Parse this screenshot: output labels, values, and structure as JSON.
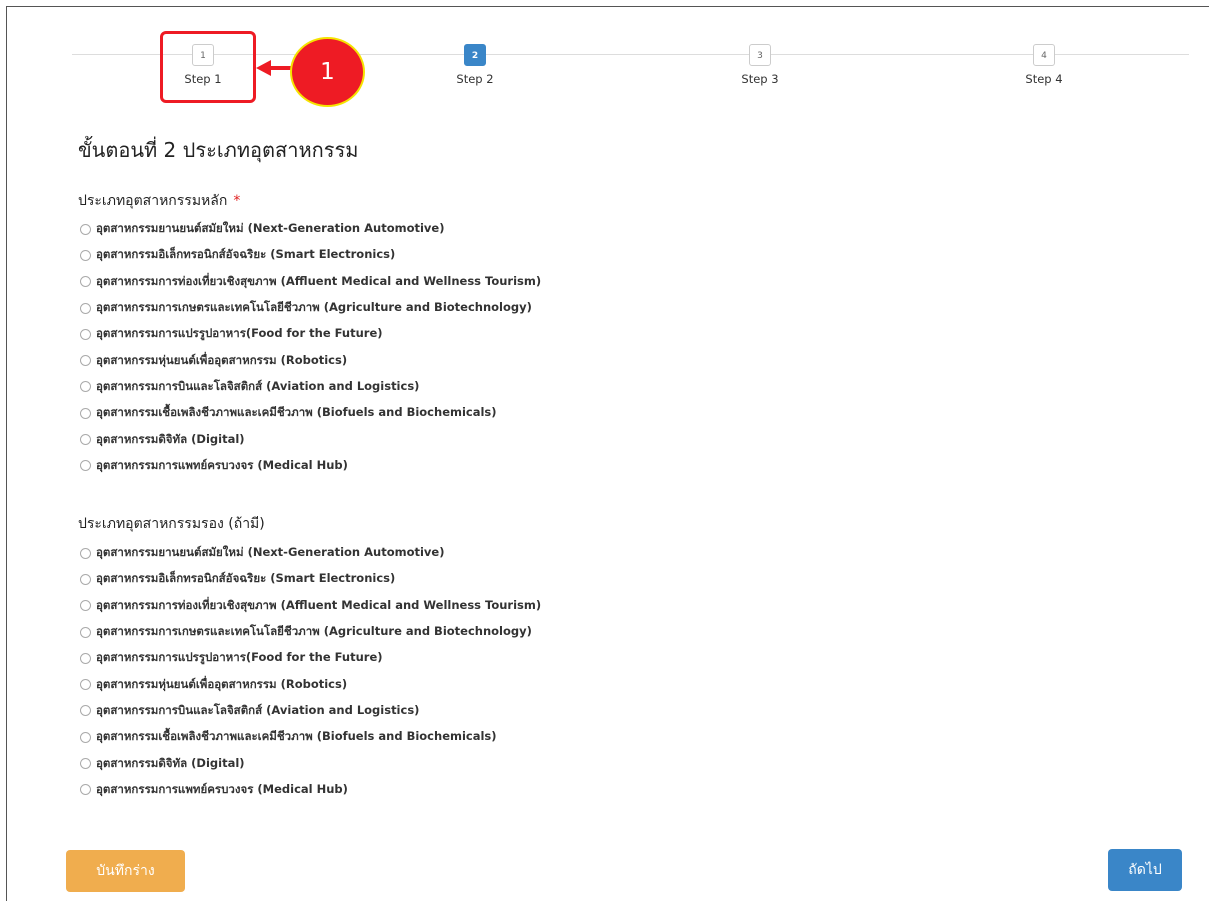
{
  "steps": [
    {
      "number": "1",
      "label": "Step 1"
    },
    {
      "number": "2",
      "label": "Step 2"
    },
    {
      "number": "3",
      "label": "Step 3"
    },
    {
      "number": "4",
      "label": "Step 4"
    }
  ],
  "active_step": "2",
  "callout": "1",
  "page_title": "ขั้นตอนที่ 2 ประเภทอุตสาหกรรม",
  "primary_group": {
    "title": "ประเภทอุตสาหกรรมหลัก",
    "required_mark": "*",
    "options": [
      "อุตสาหกรรมยานยนต์สมัยใหม่ (Next-Generation Automotive)",
      "อุตสาหกรรมอิเล็กทรอนิกส์อัจฉริยะ (Smart Electronics)",
      "อุตสาหกรรมการท่องเที่ยวเชิงสุขภาพ (Affluent Medical and Wellness Tourism)",
      "อุตสาหกรรมการเกษตรและเทคโนโลยีชีวภาพ (Agriculture and Biotechnology)",
      "อุตสาหกรรมการแปรรูปอาหาร(Food for the Future)",
      "อุตสาหกรรมหุ่นยนต์เพื่ออุตสาหกรรม (Robotics)",
      "อุตสาหกรรมการบินและโลจิสติกส์ (Aviation and Logistics)",
      "อุตสาหกรรมเชื้อเพลิงชีวภาพและเคมีชีวภาพ (Biofuels and Biochemicals)",
      "อุตสาหกรรมดิจิทัล (Digital)",
      "อุตสาหกรรมการแพทย์ครบวงจร (Medical Hub)"
    ]
  },
  "secondary_group": {
    "title": "ประเภทอุตสาหกรรมรอง (ถ้ามี)",
    "options": [
      "อุตสาหกรรมยานยนต์สมัยใหม่ (Next-Generation Automotive)",
      "อุตสาหกรรมอิเล็กทรอนิกส์อัจฉริยะ (Smart Electronics)",
      "อุตสาหกรรมการท่องเที่ยวเชิงสุขภาพ (Affluent Medical and Wellness Tourism)",
      "อุตสาหกรรมการเกษตรและเทคโนโลยีชีวภาพ (Agriculture and Biotechnology)",
      "อุตสาหกรรมการแปรรูปอาหาร(Food for the Future)",
      "อุตสาหกรรมหุ่นยนต์เพื่ออุตสาหกรรม (Robotics)",
      "อุตสาหกรรมการบินและโลจิสติกส์ (Aviation and Logistics)",
      "อุตสาหกรรมเชื้อเพลิงชีวภาพและเคมีชีวภาพ (Biofuels and Biochemicals)",
      "อุตสาหกรรมดิจิทัล (Digital)",
      "อุตสาหกรรมการแพทย์ครบวงจร (Medical Hub)"
    ]
  },
  "buttons": {
    "save_draft": "บันทึกร่าง",
    "next": "ถัดไป"
  },
  "colors": {
    "primary": "#3a86c8",
    "warning": "#f0ad4e",
    "annotation": "#ee1b24"
  }
}
